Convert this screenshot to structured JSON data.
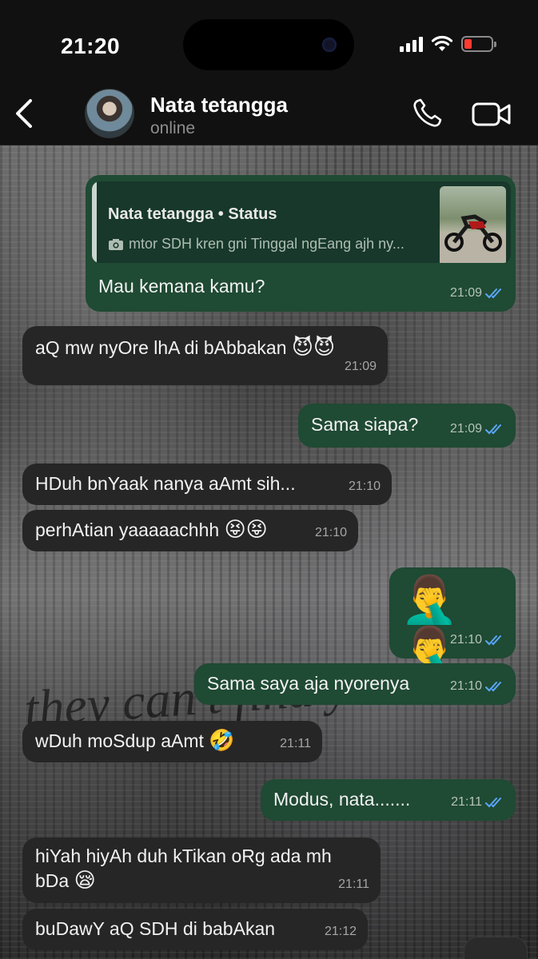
{
  "status_bar": {
    "time": "21:20"
  },
  "header": {
    "contact_name": "Nata tetangga",
    "contact_status": "online"
  },
  "background": {
    "script_text": "they can't find you in"
  },
  "quoted_status": {
    "title": "Nata tetangga • Status",
    "text": "mtor SDH kren gni Tinggal ngEang ajh ny..."
  },
  "messages": [
    {
      "dir": "out",
      "text": "Mau kemana kamu?",
      "time": "21:09"
    },
    {
      "dir": "in",
      "text": "aQ mw nyOre lhA di bAbbakan",
      "emoji": "😈😈",
      "time": "21:09"
    },
    {
      "dir": "out",
      "text": "Sama siapa?",
      "time": "21:09"
    },
    {
      "dir": "in",
      "text": "HDuh bnYaak nanya aAmt sih...",
      "time": "21:10"
    },
    {
      "dir": "in",
      "text": "perhAtian yaaaaachhh",
      "emoji": "😝😝",
      "time": "21:10"
    },
    {
      "dir": "out",
      "text": "🤦‍♂️🤦‍♂️",
      "time": "21:10"
    },
    {
      "dir": "out",
      "text": "Sama saya aja nyorenya",
      "time": "21:10"
    },
    {
      "dir": "in",
      "text": "wDuh moSdup aAmt",
      "emoji": "🤣",
      "time": "21:11"
    },
    {
      "dir": "out",
      "text": "Modus, nata.......",
      "time": "21:11"
    },
    {
      "dir": "in",
      "text": "hiYah hiyAh duh kTikan oRg ada mh",
      "text2": "bDa",
      "emoji": "😪",
      "time": "21:11"
    },
    {
      "dir": "in",
      "text": "buDawY aQ SDH di babAkan",
      "time": "21:12"
    }
  ],
  "colors": {
    "outgoing_bubble": "#1f4a33",
    "incoming_bubble": "#262626",
    "read_ticks": "#5aa7ff",
    "battery_low": "#ff3b30"
  },
  "icons": [
    "back-chevron-icon",
    "phone-icon",
    "video-camera-icon",
    "camera-icon",
    "double-check-icon",
    "signal-icon",
    "wifi-icon",
    "battery-icon"
  ]
}
